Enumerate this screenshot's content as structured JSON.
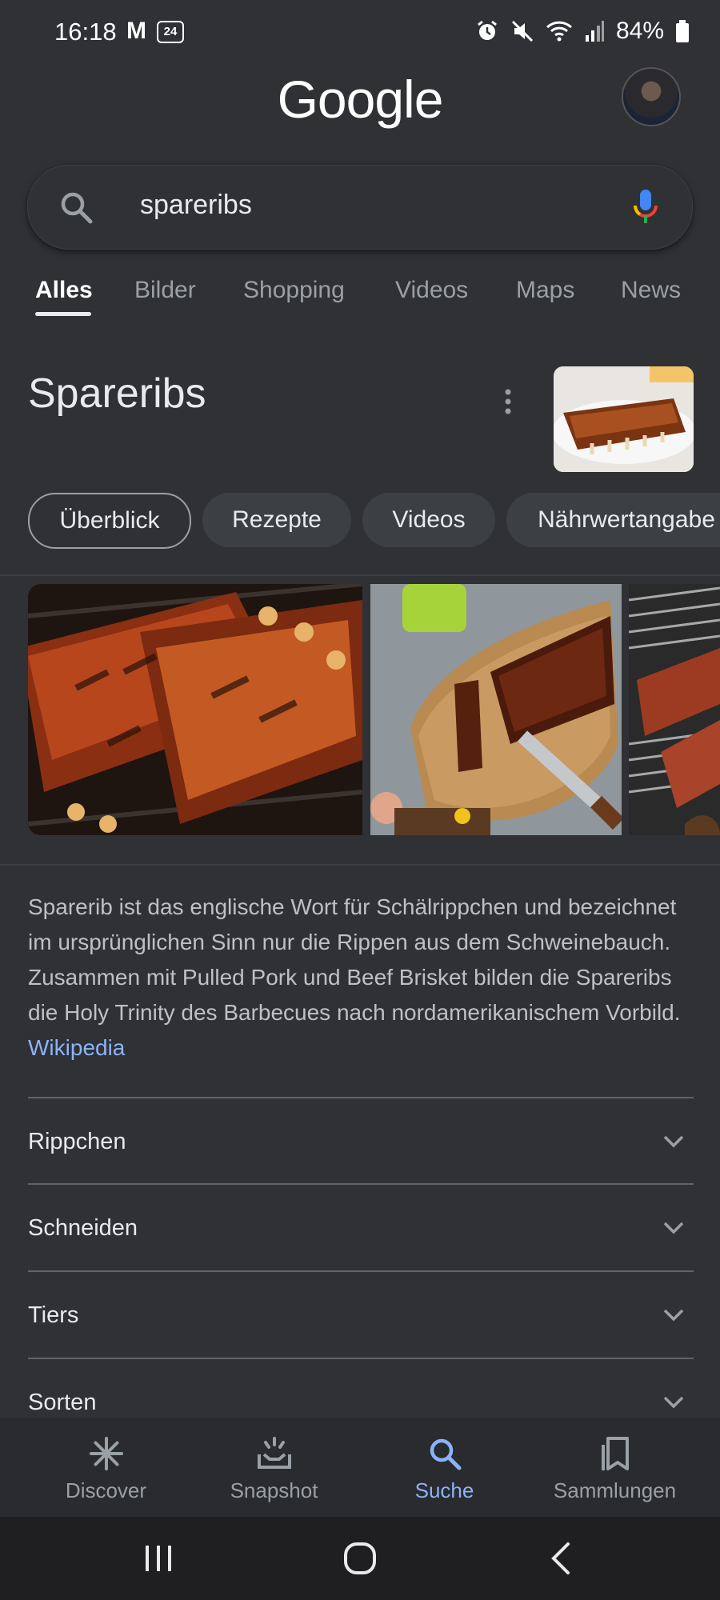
{
  "status_bar": {
    "time": "16:18",
    "app_icon_1": "M",
    "app_icon_2": "24",
    "battery": "84%",
    "icons": [
      "alarm-icon",
      "mute-icon",
      "wifi-icon",
      "signal-icon",
      "battery-icon"
    ]
  },
  "header": {
    "logo": "Google"
  },
  "search": {
    "query": "spareribs",
    "icon": "search-icon",
    "mic_icon": "mic-icon"
  },
  "tabs": [
    {
      "label": "Alles",
      "active": true
    },
    {
      "label": "Bilder"
    },
    {
      "label": "Shopping"
    },
    {
      "label": "Videos"
    },
    {
      "label": "Maps"
    },
    {
      "label": "News"
    }
  ],
  "entity": {
    "title": "Spareribs"
  },
  "chips": [
    {
      "label": "Überblick",
      "active": true
    },
    {
      "label": "Rezepte"
    },
    {
      "label": "Videos"
    },
    {
      "label": "Nährwertangabe"
    }
  ],
  "description": {
    "text": "Sparerib ist das englische Wort für Schälrippchen und bezeichnet im ursprünglichen Sinn nur die Rippen aus dem Schweinebauch. Zusammen mit Pulled Pork und Beef Brisket bilden die Spareribs die Holy Trinity des Barbecues nach nordamerikanischem Vorbild.",
    "source": "Wikipedia"
  },
  "accordion": [
    {
      "label": "Rippchen"
    },
    {
      "label": "Schneiden"
    },
    {
      "label": "Tiers"
    },
    {
      "label": "Sorten"
    }
  ],
  "bottom_nav": [
    {
      "label": "Discover",
      "icon": "asterisk-icon"
    },
    {
      "label": "Snapshot",
      "icon": "snapshot-icon"
    },
    {
      "label": "Suche",
      "icon": "search-icon",
      "active": true
    },
    {
      "label": "Sammlungen",
      "icon": "collections-icon"
    }
  ],
  "colors": {
    "background": "#303134",
    "accent": "#8ab4f8",
    "text": "#e8eaed",
    "muted": "#9aa0a6"
  }
}
